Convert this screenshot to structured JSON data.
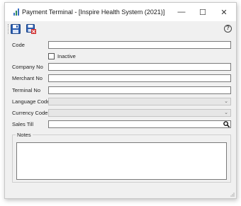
{
  "window": {
    "title": "Payment Terminal -  [Inspire Health System (2021)]",
    "controls": {
      "minimize": "—",
      "maximize": "☐",
      "close": "✕"
    }
  },
  "toolbar": {
    "save_icon": "save-icon",
    "save_delete_icon": "save-delete-icon",
    "help_glyph": "?"
  },
  "form": {
    "code_label": "Code",
    "code_value": "",
    "inactive_label": "Inactive",
    "inactive_checked": false,
    "company_no_label": "Company No",
    "company_no_value": "",
    "merchant_no_label": "Merchant No",
    "merchant_no_value": "",
    "terminal_no_label": "Terminal No",
    "terminal_no_value": "",
    "language_code_label": "Language Code",
    "language_code_value": "",
    "currency_code_label": "Currency Code",
    "currency_code_value": "",
    "sales_till_label": "Sales Till",
    "sales_till_value": "",
    "notes_label": "Notes",
    "notes_value": ""
  },
  "colors": {
    "save_blue": "#2a5db0",
    "delete_red": "#d03030",
    "app_icon_green": "#2e8b57",
    "app_icon_blue": "#3a6fc4"
  }
}
